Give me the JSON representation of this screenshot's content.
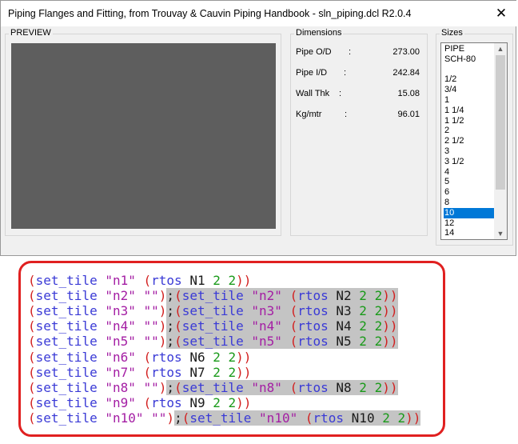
{
  "window": {
    "title": "Piping Flanges and Fitting, from Trouvay & Cauvin Piping Handbook - sln_piping.dcl R2.0.4",
    "close_glyph": "✕"
  },
  "preview": {
    "label": "PREVIEW"
  },
  "dimensions": {
    "label": "Dimensions",
    "rows": [
      {
        "label": "Pipe O/D",
        "colon": ":",
        "value": "273.00"
      },
      {
        "label": "Pipe I/D",
        "colon": ":",
        "value": "242.84"
      },
      {
        "label": "Wall Thk",
        "colon": ":",
        "value": "15.08"
      },
      {
        "label": "Kg/mtr",
        "colon": ":",
        "value": "96.01"
      }
    ]
  },
  "sizes": {
    "label": "Sizes",
    "items": [
      "PIPE",
      "SCH-80",
      "",
      "1/2",
      "3/4",
      "1",
      "1 1/4",
      "1 1/2",
      "2",
      "2 1/2",
      "3",
      "3 1/2",
      "4",
      "5",
      "6",
      "8",
      "10",
      "12",
      "14"
    ],
    "selected": "10",
    "scroll_up_glyph": "▲",
    "scroll_down_glyph": "▼"
  },
  "code": {
    "lines": [
      {
        "pre": "(set_tile \"n1\" (rtos N1 2 2))",
        "hl": ""
      },
      {
        "pre": "(set_tile \"n2\" \"\")",
        "hl": ";(set_tile \"n2\" (rtos N2 2 2))"
      },
      {
        "pre": "(set_tile \"n3\" \"\")",
        "hl": ";(set_tile \"n3\" (rtos N3 2 2))"
      },
      {
        "pre": "(set_tile \"n4\" \"\")",
        "hl": ";(set_tile \"n4\" (rtos N4 2 2))"
      },
      {
        "pre": "(set_tile \"n5\" \"\")",
        "hl": ";(set_tile \"n5\" (rtos N5 2 2))"
      },
      {
        "pre": "(set_tile \"n6\" (rtos N6 2 2))",
        "hl": ""
      },
      {
        "pre": "(set_tile \"n7\" (rtos N7 2 2))",
        "hl": ""
      },
      {
        "pre": "(set_tile \"n8\" \"\")",
        "hl": ";(set_tile \"n8\" (rtos N8 2 2))"
      },
      {
        "pre": "(set_tile \"n9\" (rtos N9 2 2))",
        "hl": ""
      },
      {
        "pre": "(set_tile \"n10\" \"\")",
        "hl": ";(set_tile \"n10\" (rtos N10 2 2))"
      }
    ]
  }
}
